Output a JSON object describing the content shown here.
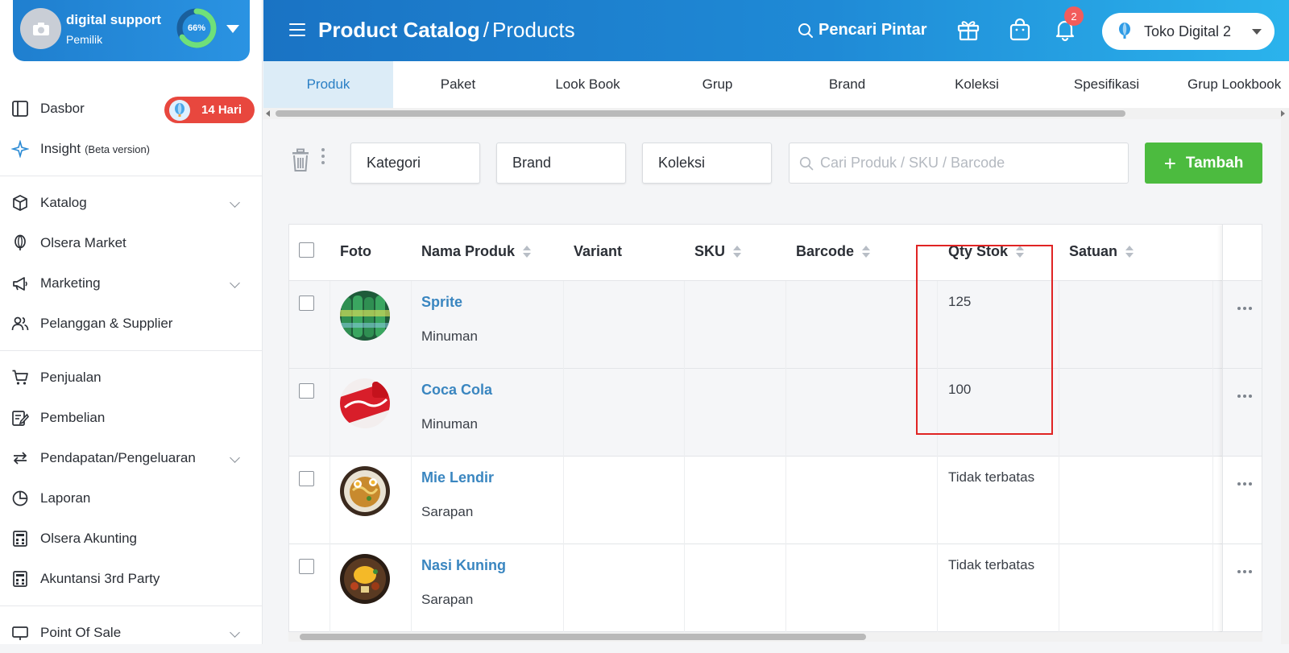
{
  "profile": {
    "name": "digital support",
    "role": "Pemilik",
    "progress": 66,
    "progress_label": "66%"
  },
  "sidebar": {
    "items": [
      {
        "label": "Dasbor",
        "icon": "dashboard-icon",
        "badge": "14 Hari"
      },
      {
        "label": "Insight",
        "icon": "sparkle-icon",
        "note": "(Beta version)"
      },
      {
        "label": "Katalog",
        "icon": "box-icon",
        "expandable": true
      },
      {
        "label": "Olsera Market",
        "icon": "balloon-icon"
      },
      {
        "label": "Marketing",
        "icon": "megaphone-icon",
        "expandable": true
      },
      {
        "label": "Pelanggan & Supplier",
        "icon": "users-icon"
      },
      {
        "label": "Penjualan",
        "icon": "cart-icon"
      },
      {
        "label": "Pembelian",
        "icon": "purchase-icon"
      },
      {
        "label": "Pendapatan/Pengeluaran",
        "icon": "exchange-icon",
        "expandable": true
      },
      {
        "label": "Laporan",
        "icon": "pie-chart-icon"
      },
      {
        "label": "Olsera Akunting",
        "icon": "calculator-icon"
      },
      {
        "label": "Akuntansi 3rd Party",
        "icon": "calculator-icon"
      },
      {
        "label": "Point Of Sale",
        "icon": "pos-icon",
        "expandable": true
      }
    ]
  },
  "header": {
    "breadcrumb_root": "Product Catalog",
    "breadcrumb_sep": "/",
    "breadcrumb_current": "Products",
    "smart_search": "Pencari Pintar",
    "notif_count": "2",
    "store": "Toko Digital 2"
  },
  "tabs": [
    {
      "label": "Produk",
      "active": true
    },
    {
      "label": "Paket"
    },
    {
      "label": "Look Book"
    },
    {
      "label": "Grup"
    },
    {
      "label": "Brand"
    },
    {
      "label": "Koleksi"
    },
    {
      "label": "Spesifikasi"
    },
    {
      "label": "Grup Lookbook"
    }
  ],
  "toolbar": {
    "filter_category": "Kategori",
    "filter_brand": "Brand",
    "filter_collection": "Koleksi",
    "search_placeholder": "Cari Produk / SKU / Barcode",
    "add_label": "Tambah"
  },
  "table": {
    "columns": [
      "Foto",
      "Nama Produk",
      "Variant",
      "SKU",
      "Barcode",
      "Qty Stok",
      "Satuan"
    ],
    "rows": [
      {
        "name": "Sprite",
        "category": "Minuman",
        "qty": "125"
      },
      {
        "name": "Coca Cola",
        "category": "Minuman",
        "qty": "100"
      },
      {
        "name": "Mie Lendir",
        "category": "Sarapan",
        "qty": "Tidak terbatas"
      },
      {
        "name": "Nasi Kuning",
        "category": "Sarapan",
        "qty": "Tidak terbatas"
      }
    ]
  },
  "colors": {
    "accent": "#1f7fcf",
    "add_button": "#4cbb3f",
    "link": "#3a86c0",
    "badge_red": "#e8473e",
    "highlight": "#e02424"
  }
}
